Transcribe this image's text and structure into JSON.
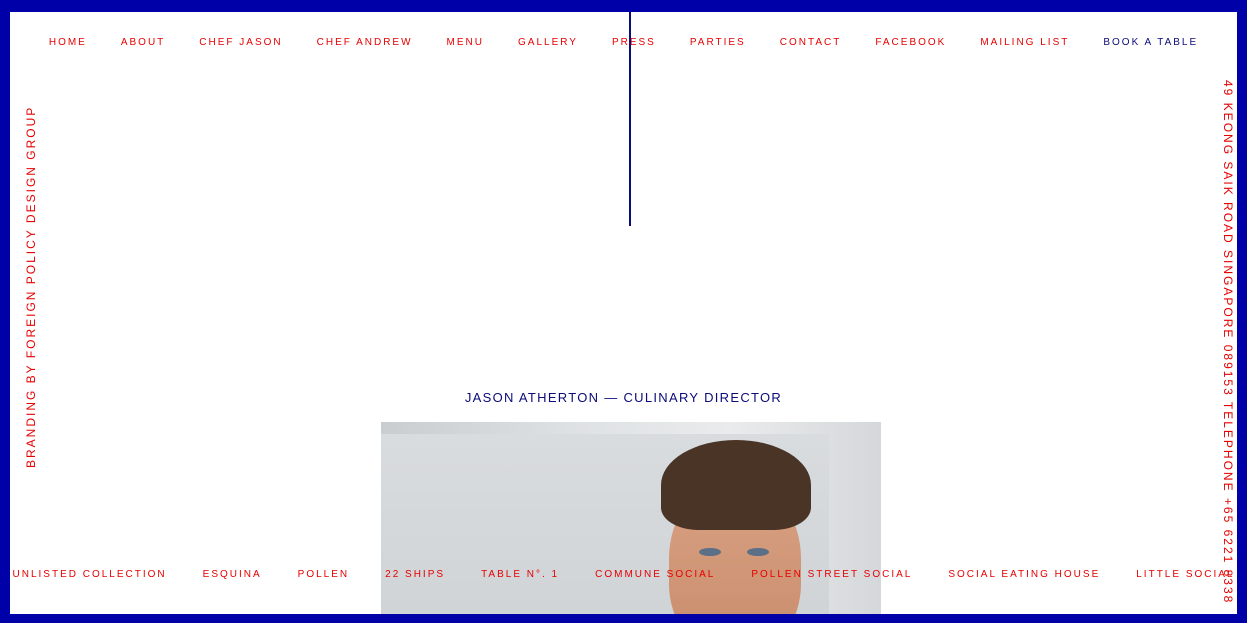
{
  "top_nav": [
    {
      "label": "HOME"
    },
    {
      "label": "ABOUT"
    },
    {
      "label": "CHEF JASON"
    },
    {
      "label": "CHEF ANDREW"
    },
    {
      "label": "MENU"
    },
    {
      "label": "GALLERY"
    },
    {
      "label": "PRESS"
    },
    {
      "label": "PARTIES"
    },
    {
      "label": "CONTACT"
    },
    {
      "label": "FACEBOOK"
    },
    {
      "label": "MAILING LIST"
    },
    {
      "label": "BOOK A TABLE"
    }
  ],
  "side_left": "BRANDING BY FOREIGN POLICY DESIGN GROUP",
  "side_right": "49 KEONG SAIK ROAD SINGAPORE 089153 TELEPHONE +65 6221 8338",
  "title": "JASON ATHERTON — CULINARY DIRECTOR",
  "bottom_nav": [
    {
      "label": "UNLISTED COLLECTION"
    },
    {
      "label": "ESQUINA"
    },
    {
      "label": "POLLEN"
    },
    {
      "label": "22 SHIPS"
    },
    {
      "label": "TABLE N°. 1"
    },
    {
      "label": "COMMUNE SOCIAL"
    },
    {
      "label": "POLLEN STREET SOCIAL"
    },
    {
      "label": "SOCIAL EATING HOUSE"
    },
    {
      "label": "LITTLE SOCIAL"
    }
  ],
  "colors": {
    "frame": "#0000a8",
    "link": "#e60000",
    "accent": "#0b0b7a",
    "background": "#ffffff"
  }
}
